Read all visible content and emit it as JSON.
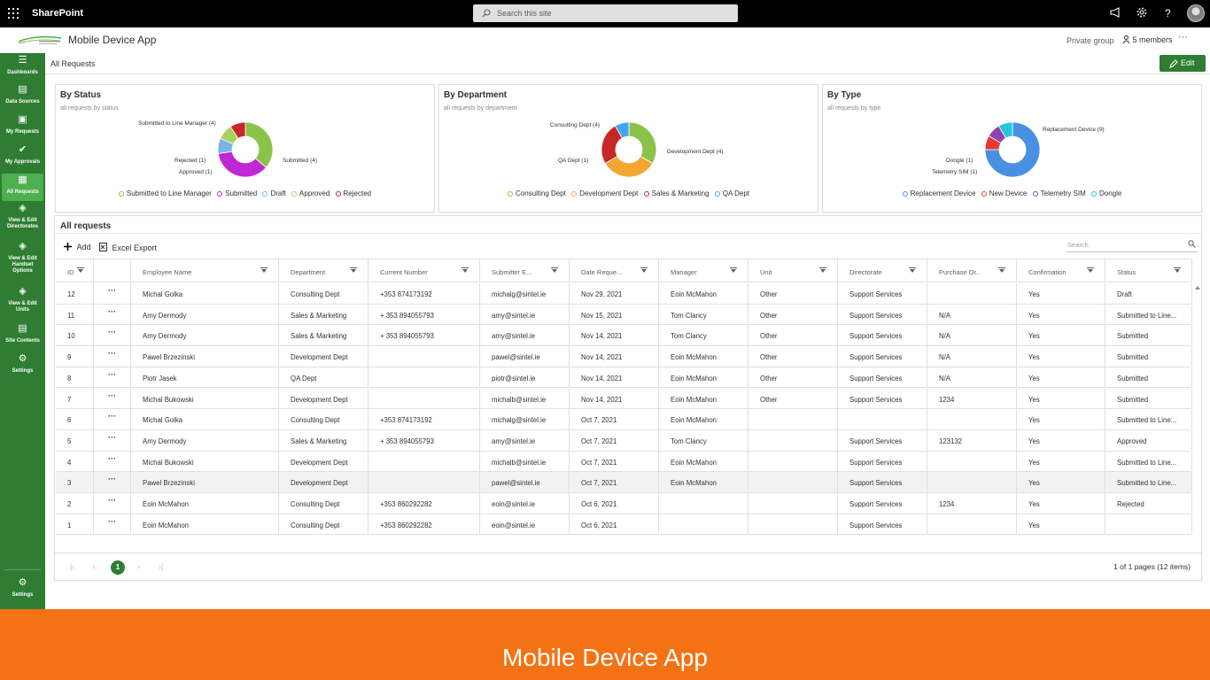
{
  "suitebar": {
    "brand": "SharePoint",
    "search_placeholder": "Search this site"
  },
  "site": {
    "title": "Mobile Device App",
    "privacy": "Private group",
    "members": "5 members"
  },
  "nav": {
    "items": [
      {
        "label": "Dashboards",
        "icon": "menu-icon"
      },
      {
        "label": "Data Sources",
        "icon": "table-icon"
      },
      {
        "label": "My Requests",
        "icon": "document-icon"
      },
      {
        "label": "My Approvals",
        "icon": "check-icon"
      },
      {
        "label": "All Requests",
        "icon": "clipboard-icon"
      },
      {
        "label": "View & Edit Directorates",
        "icon": "tag-icon"
      },
      {
        "label": "View & Edit Handset Options",
        "icon": "tag-icon"
      },
      {
        "label": "View & Edit Units",
        "icon": "tag-icon"
      },
      {
        "label": "Site Contents",
        "icon": "list-icon"
      },
      {
        "label": "Settings",
        "icon": "gear-icon"
      }
    ],
    "bottom": {
      "label": "Settings",
      "icon": "gears-icon"
    }
  },
  "page": {
    "title": "All Requests",
    "edit_label": "Edit"
  },
  "charts": {
    "status": {
      "title": "By Status",
      "subtitle": "all requests by status",
      "labels": [
        "Submitted to Line Manager (4)",
        "Submitted (4)",
        "Approved (1)",
        "Rejected (1)"
      ],
      "legend": [
        "Submitted to Line Manager",
        "Submitted",
        "Draft",
        "Approved",
        "Rejected"
      ]
    },
    "department": {
      "title": "By Department",
      "subtitle": "all requests by department",
      "labels": [
        "Consulting Dept (4)",
        "Development Dept (4)",
        "QA Dept (1)"
      ],
      "legend": [
        "Consulting Dept",
        "Development Dept",
        "Sales & Marketing",
        "QA Dept"
      ]
    },
    "type": {
      "title": "By Type",
      "subtitle": "all requests by type",
      "labels": [
        "Replacement Device (9)",
        "Dongle (1)",
        "Telemetry SIM (1)"
      ],
      "legend": [
        "Replacement Device",
        "New Device",
        "Telemetry SIM",
        "Dongle"
      ]
    }
  },
  "chart_data": [
    {
      "type": "pie",
      "title": "By Status",
      "categories": [
        "Submitted to Line Manager",
        "Submitted",
        "Draft",
        "Approved",
        "Rejected"
      ],
      "values": [
        4,
        4,
        1,
        1,
        1
      ],
      "colors": [
        "#8bc34a",
        "#c026d3",
        "#7ab3e8",
        "#a6d35c",
        "#c62828"
      ],
      "legend": "bottom"
    },
    {
      "type": "pie",
      "title": "By Department",
      "categories": [
        "Consulting Dept",
        "Development Dept",
        "Sales & Marketing",
        "QA Dept"
      ],
      "values": [
        4,
        4,
        3,
        1
      ],
      "colors": [
        "#8bc34a",
        "#f0a830",
        "#c62828",
        "#42a5f5"
      ],
      "legend": "bottom"
    },
    {
      "type": "pie",
      "title": "By Type",
      "categories": [
        "Replacement Device",
        "New Device",
        "Telemetry SIM",
        "Dongle"
      ],
      "values": [
        9,
        1,
        1,
        1
      ],
      "colors": [
        "#4a90e2",
        "#e53935",
        "#8e44ad",
        "#26c6da"
      ],
      "legend": "bottom"
    }
  ],
  "grid": {
    "title": "All requests",
    "add_label": "Add",
    "export_label": "Excel Export",
    "search_placeholder": "Search",
    "columns": [
      "ID",
      "",
      "Employee Name",
      "Department",
      "Current Number",
      "Submitter E...",
      "Date Reque...",
      "Manager",
      "Unit",
      "Directorate",
      "Purchase Or...",
      "Confirmation",
      "Status"
    ],
    "rows": [
      [
        "12",
        "···",
        "Michal Golka",
        "Consulting Dept",
        "+353 874173192",
        "michalg@sintel.ie",
        "Nov 29, 2021",
        "Eoin McMahon",
        "Other",
        "Support Services",
        "",
        "Yes",
        "Draft"
      ],
      [
        "11",
        "···",
        "Amy Dermody",
        "Sales & Marketing",
        "+ 353 894055793",
        "amy@sintel.ie",
        "Nov 15, 2021",
        "Tom Clancy",
        "Other",
        "Support Services",
        "N/A",
        "Yes",
        "Submitted to Line..."
      ],
      [
        "10",
        "···",
        "Amy Dermody",
        "Sales & Marketing",
        "+ 353 894055793",
        "amy@sintel.ie",
        "Nov 14, 2021",
        "Tom Clancy",
        "Other",
        "Support Services",
        "N/A",
        "Yes",
        "Submitted"
      ],
      [
        "9",
        "···",
        "Pawel Brzezinski",
        "Development Dept",
        "",
        "pawel@sintel.ie",
        "Nov 14, 2021",
        "Eoin McMahon",
        "Other",
        "Support Services",
        "N/A",
        "Yes",
        "Submitted"
      ],
      [
        "8",
        "···",
        "Piotr Jasek",
        "QA Dept",
        "",
        "piotr@sintel.ie",
        "Nov 14, 2021",
        "Eoin McMahon",
        "Other",
        "Support Services",
        "N/A",
        "Yes",
        "Submitted"
      ],
      [
        "7",
        "···",
        "Michal Bukowski",
        "Development Dept",
        "",
        "michalb@sintel.ie",
        "Nov 14, 2021",
        "Eoin McMahon",
        "Other",
        "Support Services",
        "1234",
        "Yes",
        "Submitted"
      ],
      [
        "6",
        "···",
        "Michal Golka",
        "Consulting Dept",
        "+353 874173192",
        "michalg@sintel.ie",
        "Oct 7, 2021",
        "Eoin McMahon",
        "",
        "",
        "",
        "Yes",
        "Submitted to Line..."
      ],
      [
        "5",
        "···",
        "Amy Dermody",
        "Sales & Marketing",
        "+ 353 894055793",
        "amy@sintel.ie",
        "Oct 7, 2021",
        "Tom Clancy",
        "",
        "Support Services",
        "123132",
        "Yes",
        "Approved"
      ],
      [
        "4",
        "···",
        "Michal Bukowski",
        "Development Dept",
        "",
        "michalb@sintel.ie",
        "Oct 7, 2021",
        "Eoin McMahon",
        "",
        "Support Services",
        "",
        "Yes",
        "Submitted to Line..."
      ],
      [
        "3",
        "···",
        "Pawel Brzezinski",
        "Development Dept",
        "",
        "pawel@sintel.ie",
        "Oct 7, 2021",
        "Eoin McMahon",
        "",
        "Support Services",
        "",
        "Yes",
        "Submitted to Line..."
      ],
      [
        "2",
        "···",
        "Eoin McMahon",
        "Consulting Dept",
        "+353 860292282",
        "eoin@sintel.ie",
        "Oct 6, 2021",
        "",
        "",
        "Support Services",
        "1234",
        "Yes",
        "Rejected"
      ],
      [
        "1",
        "···",
        "Eoin McMahon",
        "Consulting Dept",
        "+353 860292282",
        "eoin@sintel.ie",
        "Oct 6, 2021",
        "",
        "",
        "Support Services",
        "",
        "Yes",
        ""
      ]
    ],
    "highlighted_row": 9
  },
  "pager": {
    "current": "1",
    "info": "1 of 1 pages (12 items)"
  },
  "banner": {
    "text": "Mobile Device App"
  },
  "colors": {
    "nav_green": "#2e7d32",
    "nav_selected": "#4caf50",
    "banner_orange": "#f57214"
  }
}
